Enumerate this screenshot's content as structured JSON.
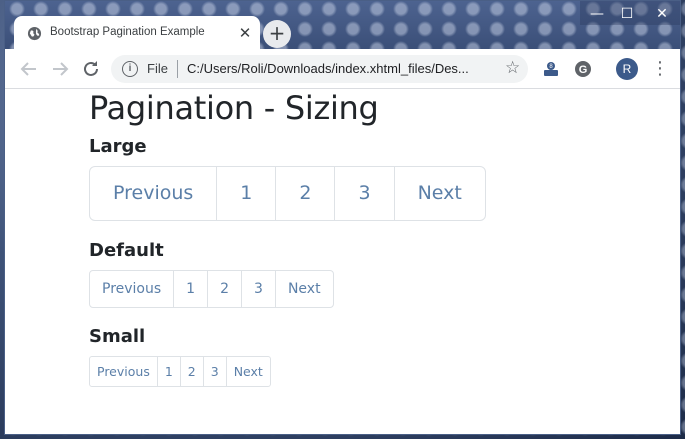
{
  "browser": {
    "tab_title": "Bootstrap Pagination Example",
    "tab_close": "✕",
    "new_tab": "+",
    "window_controls": {
      "minimize": "—",
      "maximize": "☐",
      "close": "✕"
    },
    "omnibox": {
      "scheme_label": "File",
      "url": "C:/Users/Roli/Downloads/index.xhtml_files/Des..."
    },
    "avatar_initial": "R",
    "icons": [
      "globe-icon",
      "back-arrow-icon",
      "forward-arrow-icon",
      "reload-icon",
      "info-icon",
      "star-icon",
      "extension-icon",
      "grammarly-icon",
      "menu-icon"
    ]
  },
  "page": {
    "title": "Pagination - Sizing",
    "sections": [
      {
        "label": "Large",
        "size": "lg",
        "items": [
          "Previous",
          "1",
          "2",
          "3",
          "Next"
        ]
      },
      {
        "label": "Default",
        "size": "md",
        "items": [
          "Previous",
          "1",
          "2",
          "3",
          "Next"
        ]
      },
      {
        "label": "Small",
        "size": "sm",
        "items": [
          "Previous",
          "1",
          "2",
          "3",
          "Next"
        ]
      }
    ],
    "colors": {
      "link": "#5b7fa8",
      "border": "#dee2e6",
      "heading": "#212529"
    }
  }
}
